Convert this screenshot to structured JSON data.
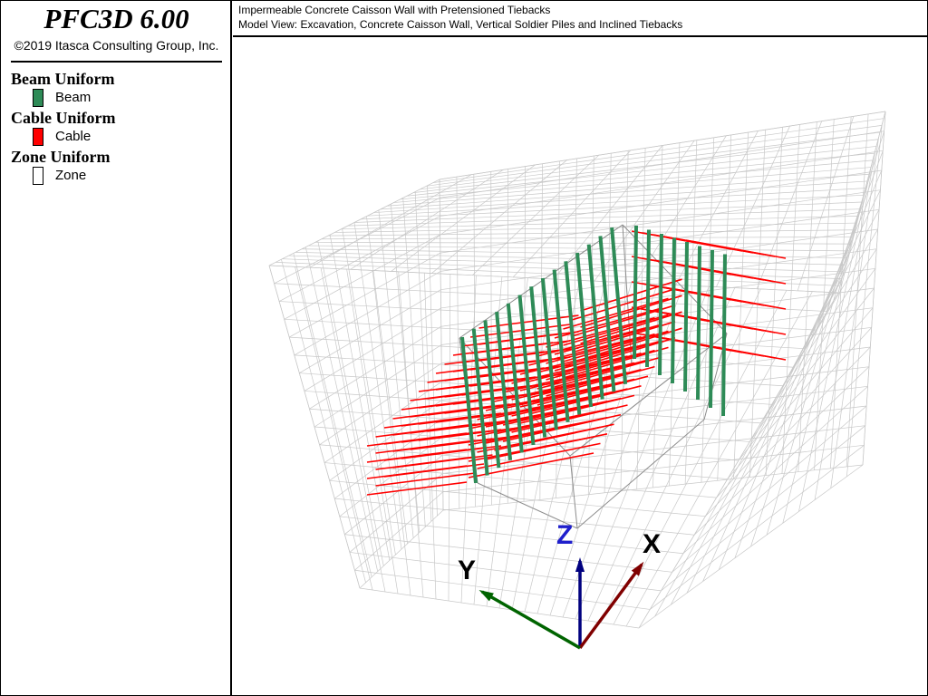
{
  "app": {
    "title": "PFC3D 6.00",
    "copyright": "©2019 Itasca Consulting Group, Inc."
  },
  "legend": [
    {
      "heading": "Beam Uniform",
      "label": "Beam",
      "color": "#2e8b57"
    },
    {
      "heading": "Cable Uniform",
      "label": "Cable",
      "color": "#ff0000"
    },
    {
      "heading": "Zone Uniform",
      "label": "Zone",
      "color": "#ffffff"
    }
  ],
  "header": {
    "line1": "Impermeable Concrete Caisson Wall with Pretensioned Tiebacks",
    "line2": "Model View: Excavation, Concrete Caisson Wall, Vertical Soldier Piles and Inclined Tiebacks"
  },
  "axes": {
    "x": {
      "label": "X",
      "color": "#800000"
    },
    "y": {
      "label": "Y",
      "color": "#006400"
    },
    "z": {
      "label": "Z",
      "color": "#00007f",
      "label_color": "#1f1fcc"
    }
  },
  "colors": {
    "grid": "#c8c8c8",
    "grid_dark": "#8c8c8c",
    "pile": "#2e8b57",
    "cable": "#ff0000"
  }
}
